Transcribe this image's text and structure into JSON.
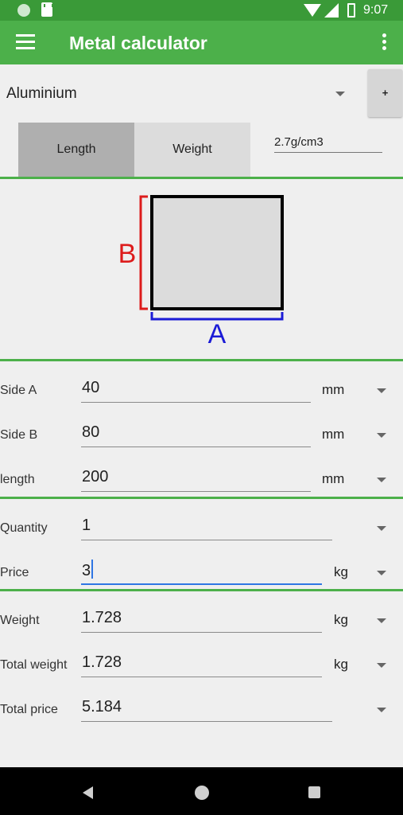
{
  "status_bar": {
    "time": "9:07"
  },
  "app_bar": {
    "title": "Metal calculator"
  },
  "material": {
    "selected": "Aluminium",
    "add_label": "+"
  },
  "tabs": [
    {
      "label": "Length"
    },
    {
      "label": "Weight"
    }
  ],
  "density": {
    "value": "2.7g/cm3"
  },
  "diagram": {
    "label_a": "A",
    "label_b": "B",
    "color_a": "#1b1bd6",
    "color_b": "#dd1c1c"
  },
  "dimensions": [
    {
      "label": "Side A",
      "value": "40",
      "unit": "mm"
    },
    {
      "label": "Side B",
      "value": "80",
      "unit": "mm"
    },
    {
      "label": "length",
      "value": "200",
      "unit": "mm"
    }
  ],
  "quantity": {
    "label": "Quantity",
    "value": "1"
  },
  "price": {
    "label": "Price",
    "value": "3",
    "unit": "kg"
  },
  "results": [
    {
      "label": "Weight",
      "value": "1.728",
      "unit": "kg"
    },
    {
      "label": "Total weight",
      "value": "1.728",
      "unit": "kg"
    },
    {
      "label": "Total price",
      "value": "5.184"
    }
  ],
  "colors": {
    "status_bar": "#3a9a38",
    "app_bar": "#4cb04a",
    "divider": "#4cb04a",
    "focus": "#2f76e3"
  }
}
